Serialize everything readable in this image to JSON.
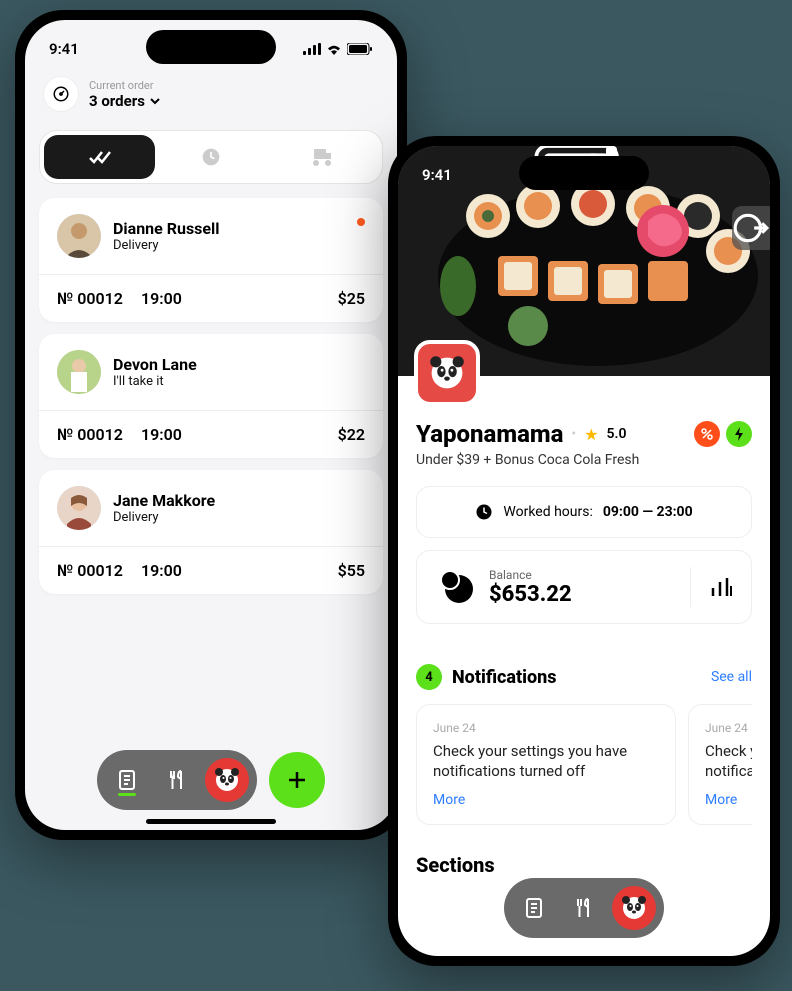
{
  "status": {
    "time": "9:41"
  },
  "phone1": {
    "header": {
      "label": "Current order",
      "value": "3 orders"
    },
    "orders": [
      {
        "name": "Dianne Russell",
        "sub": "Delivery",
        "num": "№ 00012",
        "time": "19:00",
        "price": "$25",
        "highlight": true
      },
      {
        "name": "Devon Lane",
        "sub": "I'll take it",
        "num": "№ 00012",
        "time": "19:00",
        "price": "$22",
        "highlight": false
      },
      {
        "name": "Jane Makkore",
        "sub": "Delivery",
        "num": "№ 00012",
        "time": "19:00",
        "price": "$55",
        "highlight": false
      }
    ]
  },
  "phone2": {
    "title": "Yaponamama",
    "rating": "5.0",
    "subtitle": "Under $39 + Bonus Coca Cola Fresh",
    "hours": {
      "label": "Worked hours:",
      "value": "09:00 — 23:00"
    },
    "balance": {
      "label": "Balance",
      "value": "$653.22"
    },
    "notifications": {
      "count": "4",
      "title": "Notifications",
      "see_all": "See all",
      "items": [
        {
          "date": "June 24",
          "text": "Check your settings you have notifications turned off",
          "more": "More"
        },
        {
          "date": "June 24",
          "text": "Check y\nnotificat",
          "more": "More"
        }
      ]
    },
    "sections_title": "Sections"
  }
}
